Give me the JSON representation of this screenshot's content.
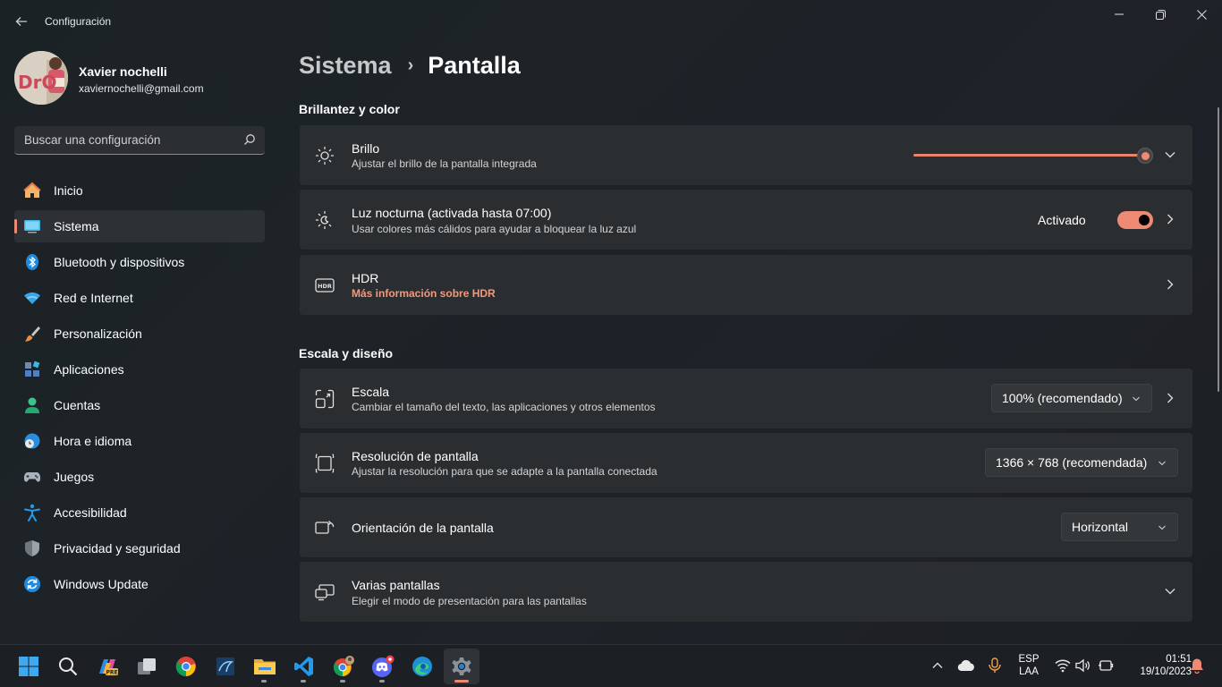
{
  "window": {
    "title": "Configuración",
    "back": "back-arrow-icon",
    "minimize": "minimize-icon",
    "restore": "restore-icon",
    "close": "close-icon"
  },
  "profile": {
    "name": "Xavier nochelli",
    "email": "xaviernochelli@gmail.com"
  },
  "search": {
    "placeholder": "Buscar una configuración"
  },
  "sidebar": {
    "items": [
      {
        "label": "Inicio",
        "icon": "home-icon"
      },
      {
        "label": "Sistema",
        "icon": "system-icon",
        "active": true
      },
      {
        "label": "Bluetooth y dispositivos",
        "icon": "bluetooth-icon"
      },
      {
        "label": "Red e Internet",
        "icon": "wifi-icon"
      },
      {
        "label": "Personalización",
        "icon": "brush-icon"
      },
      {
        "label": "Aplicaciones",
        "icon": "apps-icon"
      },
      {
        "label": "Cuentas",
        "icon": "account-icon"
      },
      {
        "label": "Hora e idioma",
        "icon": "clock-globe-icon"
      },
      {
        "label": "Juegos",
        "icon": "gamepad-icon"
      },
      {
        "label": "Accesibilidad",
        "icon": "accessibility-icon"
      },
      {
        "label": "Privacidad y seguridad",
        "icon": "shield-icon"
      },
      {
        "label": "Windows Update",
        "icon": "update-icon"
      }
    ]
  },
  "breadcrumb": {
    "parent": "Sistema",
    "separator": "›",
    "current": "Pantalla"
  },
  "sections": {
    "brightness_color": "Brillantez y color",
    "scale_layout": "Escala y diseño"
  },
  "cards": {
    "brightness": {
      "title": "Brillo",
      "subtitle": "Ajustar el brillo de la pantalla integrada",
      "level": 1.0
    },
    "night_light": {
      "title": "Luz nocturna (activada hasta 07:00)",
      "subtitle": "Usar colores más cálidos para ayudar a bloquear la luz azul",
      "state_label": "Activado",
      "on": true
    },
    "hdr": {
      "title": "HDR",
      "link": "Más información sobre HDR"
    },
    "scale": {
      "title": "Escala",
      "subtitle": "Cambiar el tamaño del texto, las aplicaciones y otros elementos",
      "value": "100% (recomendado)"
    },
    "resolution": {
      "title": "Resolución de pantalla",
      "subtitle": "Ajustar la resolución para que se adapte a la pantalla conectada",
      "value": "1366 × 768 (recomendada)"
    },
    "orientation": {
      "title": "Orientación de la pantalla",
      "value": "Horizontal"
    },
    "multi_display": {
      "title": "Varias pantallas",
      "subtitle": "Elegir el modo de presentación para las pantallas"
    }
  },
  "colors": {
    "accent": "#ee8a73",
    "card_bg": "#2b2e31",
    "link": "#f09a80"
  },
  "taskbar": {
    "apps": [
      "start-icon",
      "search-icon",
      "copilot-pre-icon",
      "task-view-icon",
      "chrome-icon",
      "vs-like-icon",
      "file-explorer-icon",
      "vscode-icon",
      "chrome-profile-icon",
      "discord-icon",
      "edge-icon",
      "settings-icon"
    ],
    "tray": {
      "language_top": "ESP",
      "language_bottom": "LAA",
      "time": "01:51",
      "date": "19/10/2023"
    }
  }
}
